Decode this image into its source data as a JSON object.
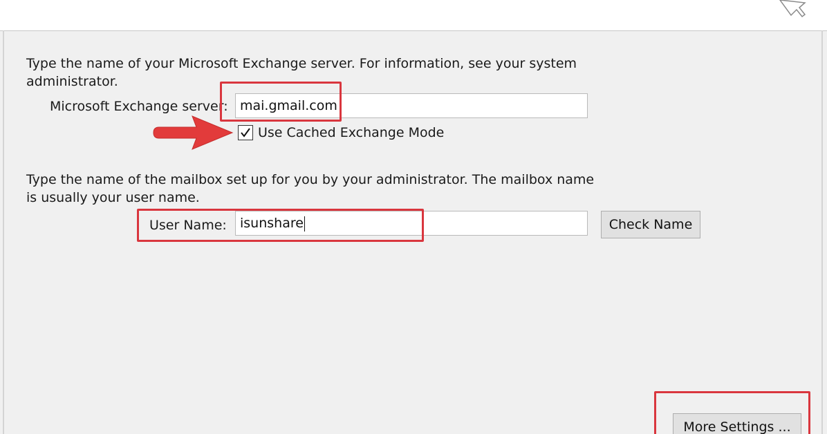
{
  "exchange": {
    "description_lines": [
      "Type the name of your Microsoft Exchange server. For information, see your system",
      "administrator."
    ],
    "server_label": "Microsoft Exchange server:",
    "server_value": "mai.gmail.com",
    "cached_mode_label": "Use Cached Exchange Mode",
    "cached_mode_checked": true
  },
  "mailbox": {
    "description_lines": [
      "Type the name of the mailbox set up for you by your administrator. The mailbox name",
      "is usually your user name."
    ],
    "user_label": "User Name:",
    "user_value": "isunshare",
    "check_name_label": "Check Name"
  },
  "footer": {
    "more_settings_label": "More Settings ..."
  },
  "colors": {
    "highlight": "#d9363e",
    "dialog_background": "#f0f0f0"
  },
  "icons": {
    "annotation_arrow": "arrow-right-icon",
    "checkbox_mark": "check-icon",
    "mouse_cursor": "cursor-icon"
  }
}
